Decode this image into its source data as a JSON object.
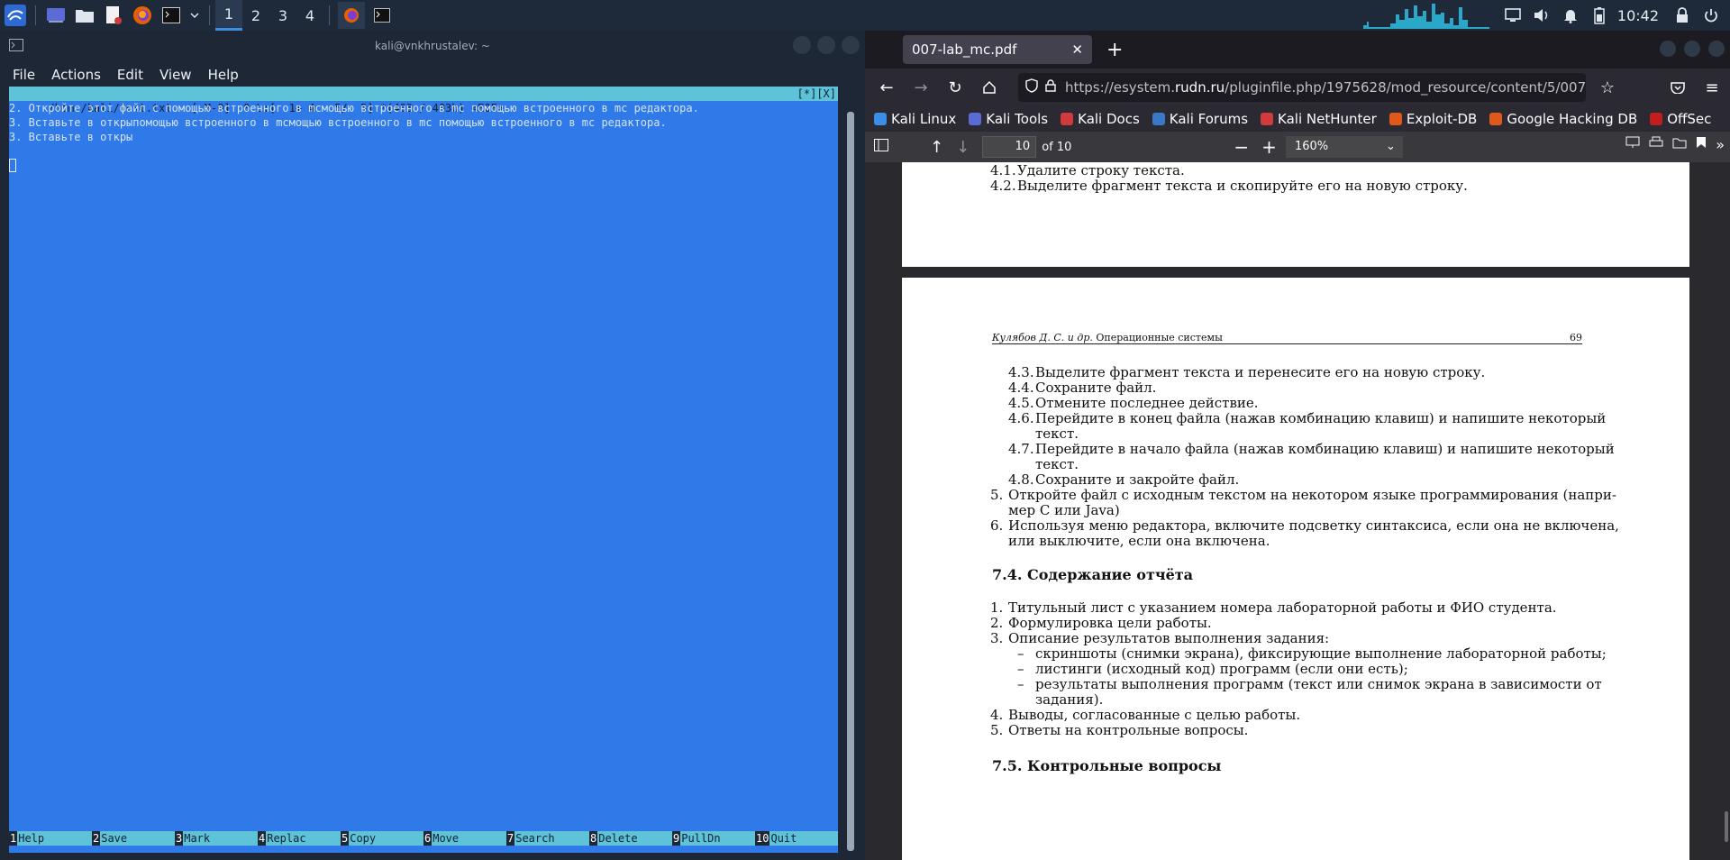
{
  "taskbar": {
    "workspaces": [
      "1",
      "2",
      "3",
      "4"
    ],
    "active_workspace": "1",
    "clock": "10:42",
    "icons": [
      "kali-menu-icon",
      "desktop-icon",
      "file-manager-icon",
      "text-editor-icon",
      "firefox-icon",
      "terminal-icon"
    ]
  },
  "terminal": {
    "title": "kali@vnkhrustalev: ~",
    "menu": [
      "File",
      "Actions",
      "Edit",
      "View",
      "Help"
    ],
    "status_left": "/home/kali/text.txt   [-M-O]  0 L:[  1+ 4   5/  5] *(403 / 403b) <EOF>",
    "status_right": "[*][X]",
    "lines": [
      "2. Откройте этот файл с помощью встроенного в mcмощью встроенного в mc помощью встроенного в mc редактора.",
      "3. Вставьте в открыпомощью встроенного в mcмощью встроенного в mc помощью встроенного в mc редактора.",
      "3. Вставьте в откры"
    ],
    "fkeys": [
      {
        "num": "1",
        "label": "Help"
      },
      {
        "num": "2",
        "label": "Save"
      },
      {
        "num": "3",
        "label": "Mark"
      },
      {
        "num": "4",
        "label": "Replac"
      },
      {
        "num": "5",
        "label": "Copy"
      },
      {
        "num": "6",
        "label": "Move"
      },
      {
        "num": "7",
        "label": "Search"
      },
      {
        "num": "8",
        "label": "Delete"
      },
      {
        "num": "9",
        "label": "PullDn"
      },
      {
        "num": "10",
        "label": "Quit"
      }
    ]
  },
  "browser": {
    "tab_title": "007-lab_mc.pdf",
    "url_prefix": "https://esystem.",
    "url_host": "rudn.ru",
    "url_rest": "/pluginfile.php/1975628/mod_resource/content/5/007",
    "bookmarks": [
      "Kali Linux",
      "Kali Tools",
      "Kali Docs",
      "Kali Forums",
      "Kali NetHunter",
      "Exploit-DB",
      "Google Hacking DB",
      "OffSec"
    ],
    "bookmark_colors": [
      "#3a8ee6",
      "#5a6bd6",
      "#d23b3b",
      "#3a78c8",
      "#d23b3b",
      "#e0581a",
      "#e0581a",
      "#c21e1e"
    ],
    "page_number": "10",
    "page_count": "of 10",
    "zoom": "160%"
  },
  "pdf": {
    "page1_lines": [
      {
        "num": "4.1.",
        "text": "Удалите строку текста."
      },
      {
        "num": "4.2.",
        "text": "Выделите фрагмент текста и скопируйте его на новую строку."
      }
    ],
    "header_left_italic": "Кулябов Д. С. и др.",
    "header_left_title": " Операционные системы",
    "header_page": "69",
    "items": [
      {
        "num": "4.3.",
        "text": "Выделите фрагмент текста и перенесите его на новую строку."
      },
      {
        "num": "4.4.",
        "text": "Сохраните файл."
      },
      {
        "num": "4.5.",
        "text": "Отмените последнее действие."
      },
      {
        "num": "4.6.",
        "text": "Перейдите в конец файла (нажав комбинацию клавиш) и напишите некоторый"
      },
      {
        "num": "",
        "text": "текст."
      },
      {
        "num": "4.7.",
        "text": "Перейдите в начало файла (нажав комбинацию клавиш) и напишите некоторый"
      },
      {
        "num": "",
        "text": "текст."
      },
      {
        "num": "4.8.",
        "text": "Сохраните и закройте файл."
      }
    ],
    "item5": "Откройте файл с исходным текстом на некотором языке программирования (напри-",
    "item5b": "мер C или Java)",
    "item6": "Используя меню редактора, включите подсветку синтаксиса, если она не включена,",
    "item6b": "или выключите, если она включена.",
    "section_74": "7.4.   Содержание отчёта",
    "report": [
      "Титульный лист с указанием номера лабораторной работы и ФИО студента.",
      "Формулировка цели работы.",
      "Описание результатов выполнения задания:"
    ],
    "report_sub": [
      "скриншоты (снимки экрана), фиксирующие выполнение лабораторной работы;",
      "листинги (исходный код) программ (если они есть);",
      "результаты выполнения программ (текст или снимок экрана в зависимости от",
      "задания)."
    ],
    "report4": "Выводы, согласованные с целью работы.",
    "report5": "Ответы на контрольные вопросы.",
    "section_75": "7.5.   Контрольные вопросы"
  }
}
